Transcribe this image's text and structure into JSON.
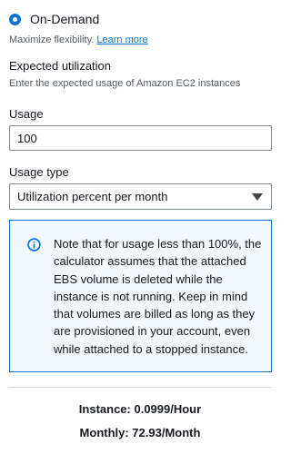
{
  "pricing_option": {
    "label": "On-Demand",
    "selected": true,
    "description": "Maximize flexibility.",
    "link_text": "Learn more"
  },
  "expected_utilization": {
    "title": "Expected utilization",
    "description": "Enter the expected usage of Amazon EC2 instances"
  },
  "usage": {
    "label": "Usage",
    "value": "100"
  },
  "usage_type": {
    "label": "Usage type",
    "selected": "Utilization percent per month"
  },
  "info_alert": {
    "icon": "info-icon",
    "text": "Note that for usage less than 100%, the calculator assumes that the attached EBS volume is deleted while the instance is not running. Keep in mind that volumes are billed as long as they are provisioned in your account, even while attached to a stopped instance."
  },
  "summary": {
    "instance": "Instance: 0.0999/Hour",
    "monthly": "Monthly: 72.93/Month"
  },
  "colors": {
    "accent": "#0972d3",
    "alert_background": "#f2f8fd"
  }
}
